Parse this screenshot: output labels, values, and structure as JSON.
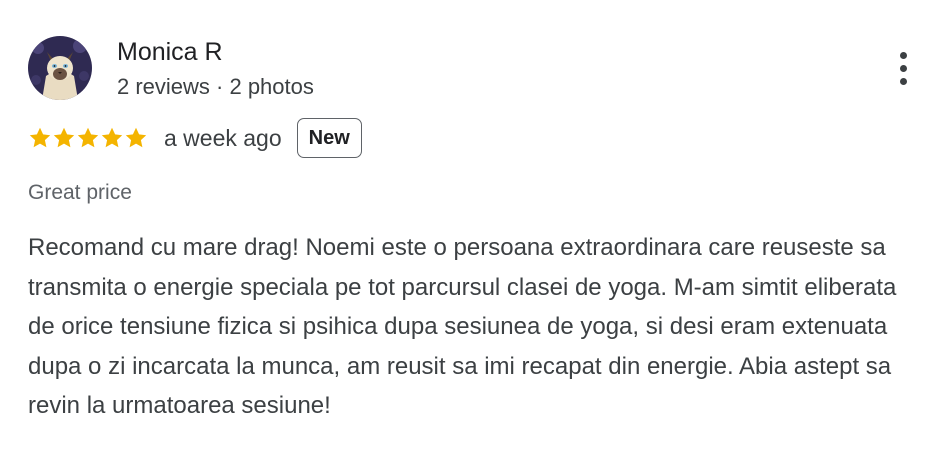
{
  "author": {
    "name": "Monica R",
    "meta": "2 reviews · 2 photos",
    "avatar_icon": "cat-avatar-icon"
  },
  "rating": {
    "stars": 5,
    "max_stars": 5,
    "star_color": "#f4b400",
    "timestamp": "a week ago",
    "badge": "New"
  },
  "highlight": "Great price",
  "review_text": "Recomand cu mare drag! Noemi este o persoana extraordinara care reuseste sa transmita o energie speciala pe tot parcursul clasei de yoga. M-am simtit eliberata de orice tensiune fizica si psihica dupa sesiunea de yoga, si desi eram extenuata dupa o zi incarcata la munca, am reusit sa imi recapat din energie. Abia astept sa revin la urmatoarea sesiune!",
  "menu_icon": "more-vert-icon"
}
